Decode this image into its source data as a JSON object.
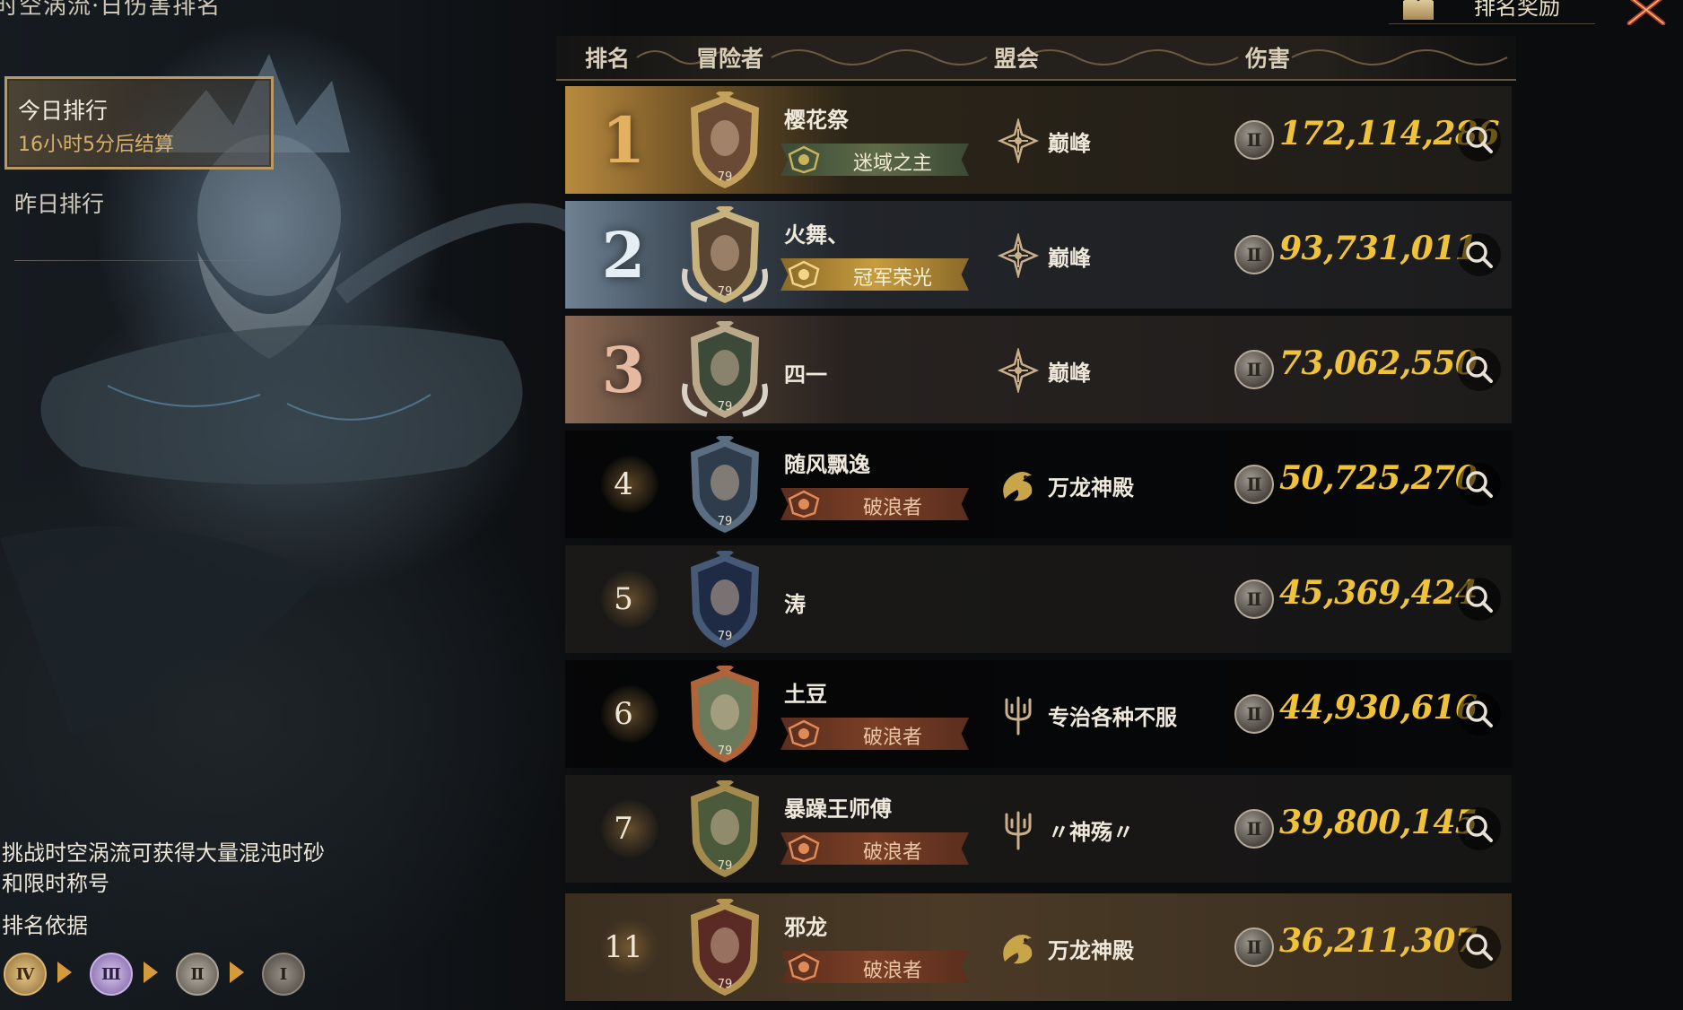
{
  "header": {
    "title": "时空涡流·日伤害排名",
    "reward_label": "排名奖励",
    "reward_icon": "reward-chart-icon",
    "close_icon": "close-icon"
  },
  "tabs": {
    "today_label": "今日排行",
    "today_countdown": "16小时5分后结算",
    "yesterday_label": "昨日排行"
  },
  "info": {
    "tip": "挑战时空涡流可获得大量混沌时砂和限时称号",
    "basis_label": "排名依据",
    "tiers": [
      "Ⅳ",
      "Ⅲ",
      "Ⅱ",
      "Ⅰ"
    ]
  },
  "columns": {
    "rank": "排名",
    "adventurer": "冒险者",
    "guild": "盟会",
    "damage": "伤害"
  },
  "rows": [
    {
      "rank": "1",
      "name": "樱花祭",
      "level": "79",
      "title": "迷域之主",
      "guild": "巅峰",
      "guild_icon": "guild-peak-icon",
      "tier": "Ⅱ",
      "damage": "172,114,286"
    },
    {
      "rank": "2",
      "name": "火舞、",
      "level": "79",
      "title": "冠军荣光",
      "guild": "巅峰",
      "guild_icon": "guild-peak-icon",
      "tier": "Ⅱ",
      "damage": "93,731,011"
    },
    {
      "rank": "3",
      "name": "四一",
      "level": "79",
      "title": "",
      "guild": "巅峰",
      "guild_icon": "guild-peak-icon",
      "tier": "Ⅱ",
      "damage": "73,062,550"
    },
    {
      "rank": "4",
      "name": "随风飘逸",
      "level": "79",
      "title": "破浪者",
      "guild": "万龙神殿",
      "guild_icon": "guild-dragon-icon",
      "tier": "Ⅱ",
      "damage": "50,725,270"
    },
    {
      "rank": "5",
      "name": "涛",
      "level": "79",
      "title": "",
      "guild": "",
      "guild_icon": "",
      "tier": "Ⅱ",
      "damage": "45,369,424"
    },
    {
      "rank": "6",
      "name": "土豆",
      "level": "79",
      "title": "破浪者",
      "guild": "专治各种不服",
      "guild_icon": "guild-trident-icon",
      "tier": "Ⅱ",
      "damage": "44,930,616"
    },
    {
      "rank": "7",
      "name": "暴躁王师傅",
      "level": "79",
      "title": "破浪者",
      "guild": "〃神殇〃",
      "guild_icon": "guild-trident-icon",
      "tier": "Ⅱ",
      "damage": "39,800,145"
    },
    {
      "rank": "11",
      "name": "邪龙",
      "level": "79",
      "title": "破浪者",
      "guild": "万龙神殿",
      "guild_icon": "guild-dragon-icon",
      "tier": "Ⅱ",
      "damage": "36,211,307"
    }
  ],
  "colors": {
    "gold": "#f0c23a",
    "rank1": "#c98a2e",
    "rank2": "#9fb3c4",
    "rank3": "#c49577",
    "highlight_row": "#4a3a26"
  }
}
